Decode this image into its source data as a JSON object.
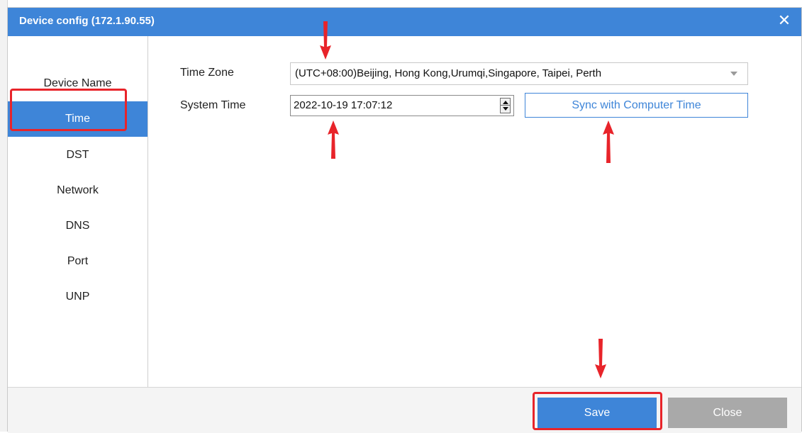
{
  "dialog": {
    "title": "Device config (172.1.90.55)",
    "close_glyph": "✕"
  },
  "sidebar": {
    "items": [
      {
        "label": "Device Name"
      },
      {
        "label": "Time"
      },
      {
        "label": "DST"
      },
      {
        "label": "Network"
      },
      {
        "label": "DNS"
      },
      {
        "label": "Port"
      },
      {
        "label": "UNP"
      }
    ],
    "selected": "Time"
  },
  "time": {
    "timezone_label": "Time Zone",
    "timezone_value": "(UTC+08:00)Beijing, Hong Kong,Urumqi,Singapore, Taipei, Perth",
    "system_time_label": "System Time",
    "system_time_value": "2022-10-19 17:07:12",
    "sync_label": "Sync with Computer Time"
  },
  "footer": {
    "save_label": "Save",
    "close_label": "Close"
  },
  "colors": {
    "accent": "#3e85d8",
    "annotation": "#e8242a",
    "disabled_button": "#a9a9a9"
  },
  "icons": [
    "close-icon",
    "dropdown-caret-icon",
    "spinner-up-icon",
    "spinner-down-icon",
    "annotation-arrow-icon"
  ]
}
